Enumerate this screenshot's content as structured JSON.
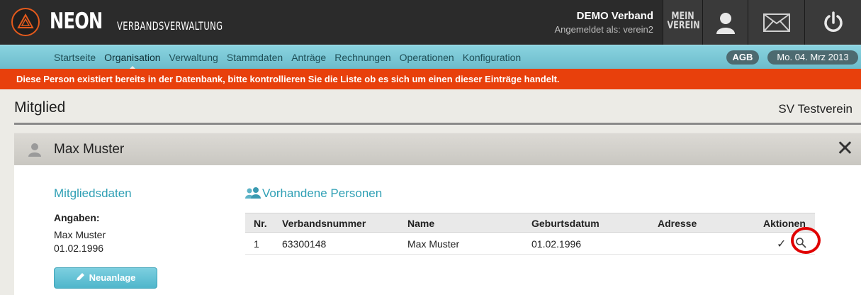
{
  "header": {
    "brand": "NEON",
    "brand_sub": "VERBANDSVERWALTUNG",
    "org_name": "DEMO Verband",
    "logged_in": "Angemeldet als: verein2",
    "mein_line1": "MEIN",
    "mein_line2": "VEREIN",
    "icons": [
      "user-icon",
      "mail-icon",
      "power-icon"
    ]
  },
  "nav": {
    "items": [
      "Startseite",
      "Organisation",
      "Verwaltung",
      "Stammdaten",
      "Anträge",
      "Rechnungen",
      "Operationen",
      "Konfiguration"
    ],
    "active": "Organisation",
    "agb": "AGB",
    "date": "Mo. 04. Mrz 2013"
  },
  "alert": {
    "text": "Diese Person existiert bereits in der Datenbank, bitte kontrollieren Sie die Liste ob es sich um einen dieser Einträge handelt."
  },
  "page": {
    "title": "Mitglied",
    "club": "SV Testverein"
  },
  "person": {
    "name": "Max Muster"
  },
  "member_data": {
    "title": "Mitgliedsdaten",
    "label": "Angaben:",
    "line1": "Max Muster",
    "line2": "01.02.1996",
    "new_button": "Neuanlage"
  },
  "existing": {
    "title": "Vorhandene Personen",
    "columns": {
      "nr": "Nr.",
      "verbandsnummer": "Verbandsnummer",
      "name": "Name",
      "geburtsdatum": "Geburtsdatum",
      "adresse": "Adresse",
      "aktionen": "Aktionen"
    },
    "rows": [
      {
        "nr": "1",
        "verbandsnummer": "63300148",
        "name": "Max Muster",
        "geburtsdatum": "01.02.1996",
        "adresse": ""
      }
    ]
  },
  "colors": {
    "accent": "#2e9fb4",
    "alert": "#e8400c",
    "nav": "#7cc8d6",
    "highlight": "#e00000"
  }
}
